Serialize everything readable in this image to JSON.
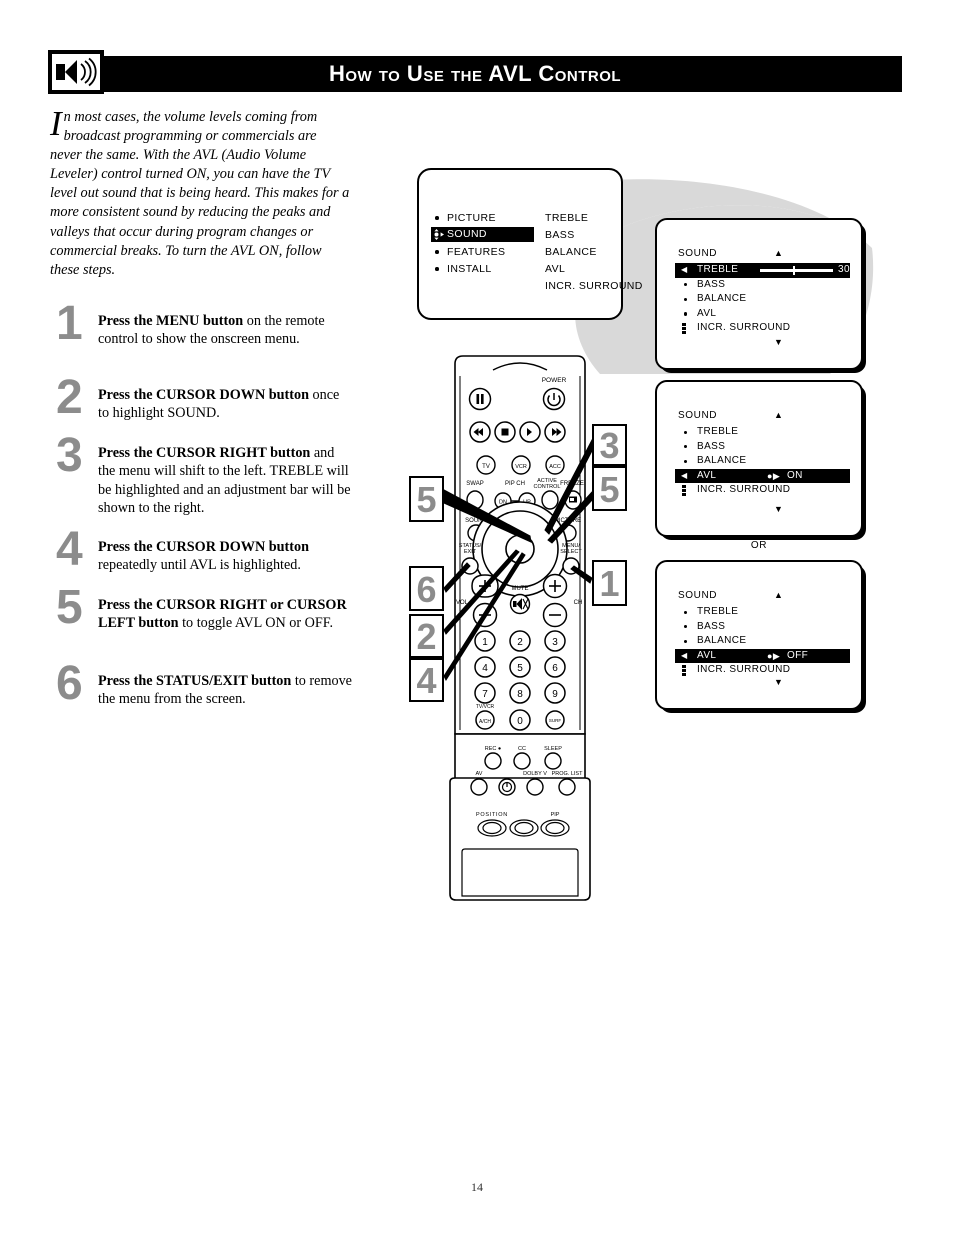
{
  "header": {
    "title": "How to Use the AVL Control",
    "icon": "speaker-sound-icon"
  },
  "intro": {
    "dropcap": "I",
    "text": "n most cases, the volume levels coming from broadcast programming or commercials are never the same.  With the AVL (Audio Volume Leveler) control turned ON, you can have the TV level out sound that is being heard.  This makes for a more consistent sound by reducing the peaks and valleys that occur during program changes or commercial breaks.  To turn the AVL ON, follow these steps."
  },
  "steps": [
    {
      "number": "1",
      "bold": "Press the MENU button",
      "rest": " on the remote control to show the onscreen menu."
    },
    {
      "number": "2",
      "bold": "Press the CURSOR DOWN button",
      "rest": " once to highlight SOUND."
    },
    {
      "number": "3",
      "bold": "Press the CURSOR RIGHT button",
      "rest": " and the menu will shift to the left. TREBLE will be highlighted and an adjustment bar will be shown to the right."
    },
    {
      "number": "4",
      "bold": "Press the CURSOR DOWN button",
      "rest": " repeatedly until AVL is highlighted."
    },
    {
      "number": "5",
      "bold": "Press the CURSOR RIGHT or CURSOR LEFT button",
      "rest": " to toggle AVL ON or OFF."
    },
    {
      "number": "6",
      "bold": "Press the STATUS/EXIT button",
      "rest": " to remove the menu from the screen."
    }
  ],
  "tv_menu": {
    "left_items": [
      {
        "label": "PICTURE",
        "selected": false
      },
      {
        "label": "SOUND",
        "selected": true
      },
      {
        "label": "FEATURES",
        "selected": false
      },
      {
        "label": "INSTALL",
        "selected": false
      }
    ],
    "right_items": [
      "TREBLE",
      "BASS",
      "BALANCE",
      "AVL",
      "INCR.  SURROUND"
    ]
  },
  "osd_panels": [
    {
      "id": "osd-treble",
      "title": "SOUND",
      "up_arrow": "▲",
      "down_arrow": "▼",
      "items": [
        {
          "label": "TREBLE",
          "highlighted": true,
          "control": "slider",
          "value": "30"
        },
        {
          "label": "BASS",
          "highlighted": false,
          "control": "none",
          "value": ""
        },
        {
          "label": "BALANCE",
          "highlighted": false,
          "control": "none",
          "value": ""
        },
        {
          "label": "AVL",
          "highlighted": false,
          "control": "none",
          "value": ""
        },
        {
          "label": "INCR.  SURROUND",
          "highlighted": false,
          "control": "none",
          "value": ""
        }
      ]
    },
    {
      "id": "osd-avl-on",
      "title": "SOUND",
      "up_arrow": "▲",
      "down_arrow": "▼",
      "items": [
        {
          "label": "TREBLE",
          "highlighted": false,
          "control": "none",
          "value": ""
        },
        {
          "label": "BASS",
          "highlighted": false,
          "control": "none",
          "value": ""
        },
        {
          "label": "BALANCE",
          "highlighted": false,
          "control": "none",
          "value": ""
        },
        {
          "label": "AVL",
          "highlighted": true,
          "control": "toggle",
          "value": "ON"
        },
        {
          "label": "INCR.  SURROUND",
          "highlighted": false,
          "control": "none",
          "value": ""
        }
      ]
    },
    {
      "id": "osd-avl-off",
      "title": "SOUND",
      "up_arrow": "▲",
      "down_arrow": "▼",
      "items": [
        {
          "label": "TREBLE",
          "highlighted": false,
          "control": "none",
          "value": ""
        },
        {
          "label": "BASS",
          "highlighted": false,
          "control": "none",
          "value": ""
        },
        {
          "label": "BALANCE",
          "highlighted": false,
          "control": "none",
          "value": ""
        },
        {
          "label": "AVL",
          "highlighted": true,
          "control": "toggle",
          "value": "OFF"
        },
        {
          "label": "INCR.  SURROUND",
          "highlighted": false,
          "control": "none",
          "value": ""
        }
      ]
    }
  ],
  "or_label": "OR",
  "callouts": [
    {
      "id": "callout-5L",
      "number": "5"
    },
    {
      "id": "callout-3R",
      "number": "3"
    },
    {
      "id": "callout-5R",
      "number": "5"
    },
    {
      "id": "callout-6L",
      "number": "6"
    },
    {
      "id": "callout-1R",
      "number": "1"
    },
    {
      "id": "callout-2L",
      "number": "2"
    },
    {
      "id": "callout-4L",
      "number": "4"
    }
  ],
  "remote": {
    "labels": {
      "power": "POWER",
      "tv": "TV",
      "vcr": "VCR",
      "acc": "ACC",
      "swap": "SWAP",
      "pip_ch": "PIP CH",
      "dn": "DN",
      "up": "UP",
      "active_control": "ACTIVE CONTROL",
      "freeze": "FREEZE",
      "sound": "SOUND",
      "picture": "PICTURE",
      "status_exit": "STATUS/ EXIT",
      "menu_select": "MENU/ SELECT",
      "vol": "VOL",
      "ch": "CH",
      "mute": "MUTE",
      "tv_vcr": "TV/VCR",
      "a_ch": "A/CH",
      "surf": "SURF",
      "rec": "REC",
      "cc": "CC",
      "sleep": "SLEEP",
      "av": "AV",
      "dolby_v": "DOLBY V",
      "prog_list": "PROG. LIST",
      "position": "POSITION",
      "pip": "PIP"
    },
    "keypad": [
      "1",
      "2",
      "3",
      "4",
      "5",
      "6",
      "7",
      "8",
      "9",
      "0"
    ]
  },
  "page_number": "14"
}
